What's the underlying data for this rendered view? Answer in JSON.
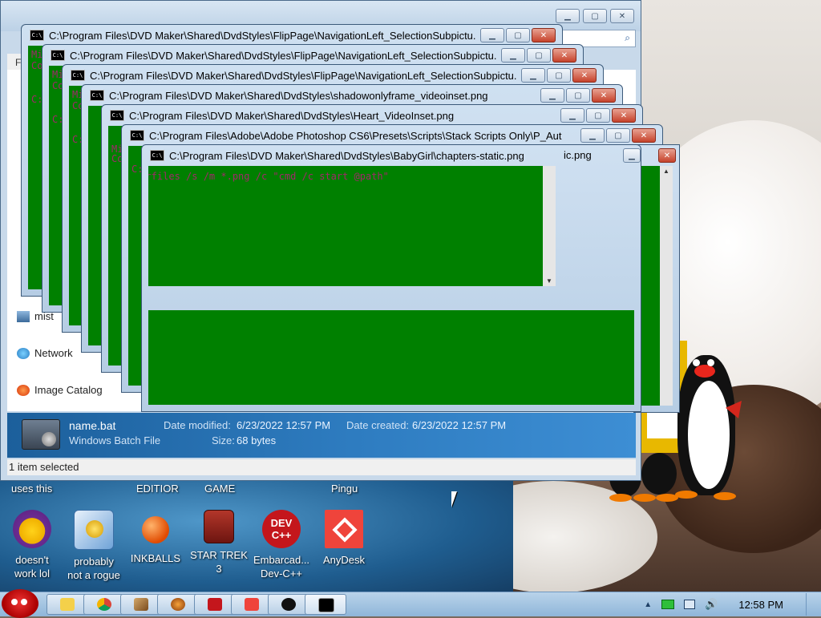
{
  "explorer": {
    "menu_stub": "F",
    "nav_items": [
      {
        "label": "mist",
        "icon": "network-computer-icon"
      },
      {
        "label": "Network",
        "icon": "network-icon"
      },
      {
        "label": "Image Catalog",
        "icon": "image-catalog-icon"
      }
    ],
    "details": {
      "file_name": "name.bat",
      "file_type": "Windows Batch File",
      "date_modified_label": "Date modified:",
      "date_modified_value": "6/23/2022 12:57 PM",
      "date_created_label": "Date created:",
      "date_created_value": "6/23/2022 12:57 PM",
      "size_label": "Size:",
      "size_value": "68 bytes"
    },
    "status": "1 item selected"
  },
  "cmd_windows": [
    {
      "title": "C:\\Program Files\\DVD Maker\\Shared\\DvdStyles\\FlipPage\\NavigationLeft_SelectionSubpictu..."
    },
    {
      "title": "C:\\Program Files\\DVD Maker\\Shared\\DvdStyles\\FlipPage\\NavigationLeft_SelectionSubpictu..."
    },
    {
      "title": "C:\\Program Files\\DVD Maker\\Shared\\DvdStyles\\FlipPage\\NavigationLeft_SelectionSubpictu..."
    },
    {
      "title": "C:\\Program Files\\DVD Maker\\Shared\\DvdStyles\\shadowonlyframe_videoinset.png"
    },
    {
      "title": "C:\\Program Files\\DVD Maker\\Shared\\DvdStyles\\Heart_VideoInset.png"
    },
    {
      "title": "C:\\Program Files\\Adobe\\Adobe Photoshop CS6\\Presets\\Scripts\\Stack Scripts Only\\P_Aut"
    },
    {
      "title": "C:\\Program Files\\DVD Maker\\Shared\\DvdStyles\\BabyGirl\\chapters-static.png",
      "tail": "ic.png"
    }
  ],
  "cmd_text": {
    "partial_lines": [
      "Mi",
      "Co",
      "",
      "C:"
    ],
    "command_line": "forfiles /s /m *.png /c \"cmd /c start @path\""
  },
  "desktop": {
    "groups": [
      "uses this",
      "EDITIOR",
      "GAME",
      "Pingu"
    ],
    "icons": [
      {
        "label": "doesn't\nwork lol",
        "icon": "yahoo-messenger-icon"
      },
      {
        "label": "probably\nnot a rogue",
        "icon": "settings-gears-icon"
      },
      {
        "label": "INKBALLS",
        "icon": "inkball-icon"
      },
      {
        "label": "STAR TREK\n3",
        "icon": "star-trek-icon"
      },
      {
        "label": "Embarcad...\nDev-C++",
        "icon": "dev-cpp-icon"
      },
      {
        "label": "AnyDesk",
        "icon": "anydesk-icon"
      }
    ],
    "dev_cpp_badge": "DEV\nC++"
  },
  "taskbar": {
    "buttons": [
      "folder-icon",
      "chrome-icon",
      "tool-icon",
      "game-icon",
      "pdf-icon",
      "anydesk-icon",
      "angry-bird-icon",
      "cmd-icon"
    ],
    "clock": "12:58 PM"
  },
  "colors": {
    "cmd_background": "#008000",
    "cmd_text": "#a0286a",
    "details_pane": "#2e7cc0"
  }
}
